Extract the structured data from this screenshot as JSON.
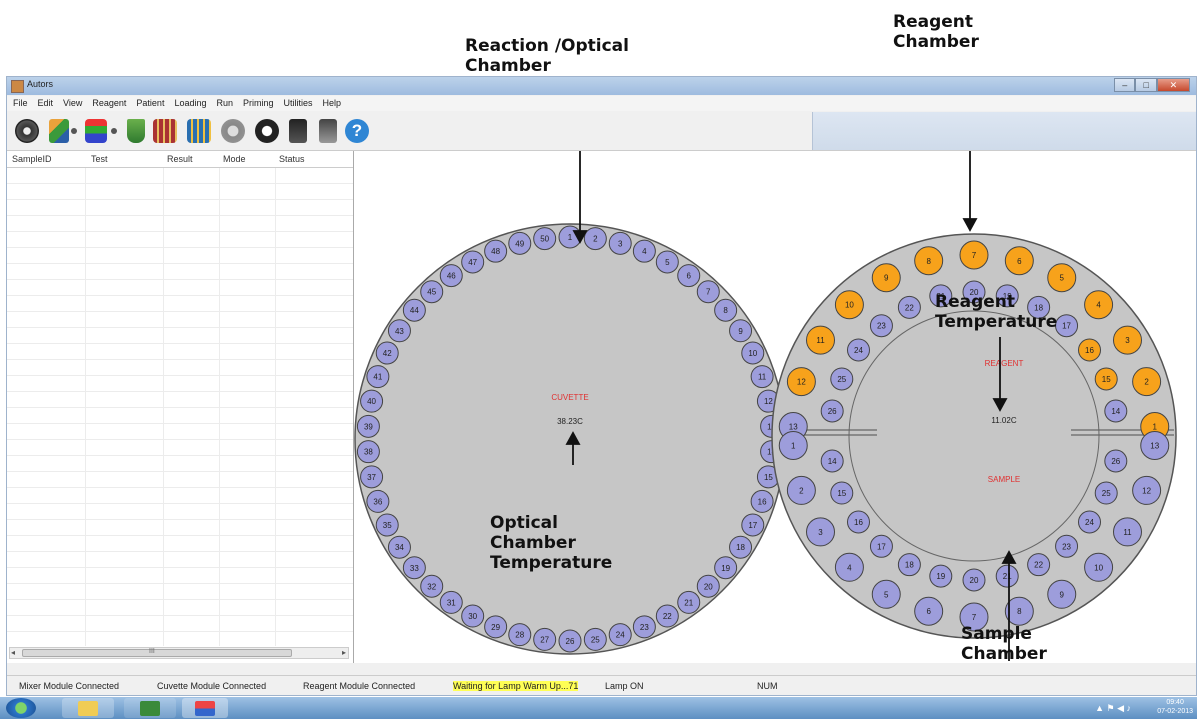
{
  "annotations": {
    "reaction_chamber": "Reaction /Optical\nChamber",
    "reagent_chamber": "Reagent\nChamber",
    "reagent_temperature": "Reagent\nTemperature",
    "optical_temperature": "Optical\nChamber\nTemperature",
    "sample_chamber": "Sample\nChamber"
  },
  "window": {
    "title": "Autors",
    "menu": [
      "File",
      "Edit",
      "View",
      "Reagent",
      "Patient",
      "Loading",
      "Run",
      "Priming",
      "Utilities",
      "Help"
    ]
  },
  "toolbar_icons": [
    "disc-icon",
    "tree-icon",
    "flask-stack-icon",
    "flask-icon",
    "bar-chart-icon",
    "bar-chart-2-icon",
    "play-icon",
    "stop-icon",
    "lamp-off-icon",
    "lamp-on-icon",
    "help-icon"
  ],
  "table": {
    "columns": [
      "SampleID",
      "Test",
      "Result",
      "Mode",
      "Status"
    ],
    "scroll_marker": "III"
  },
  "cuvette": {
    "label": "CUVETTE",
    "temperature": "38.23C",
    "positions": [
      "1",
      "2",
      "3",
      "4",
      "5",
      "6",
      "7",
      "8",
      "9",
      "10",
      "11",
      "12",
      "13",
      "14",
      "15",
      "16",
      "17",
      "18",
      "19",
      "20",
      "21",
      "22",
      "23",
      "24",
      "25",
      "26",
      "27",
      "28",
      "29",
      "30",
      "31",
      "32",
      "33",
      "34",
      "35",
      "36",
      "37",
      "38",
      "39",
      "40",
      "41",
      "42",
      "43",
      "44",
      "45",
      "46",
      "47",
      "48",
      "49",
      "50"
    ]
  },
  "reagent_tray": {
    "reagent_label": "REAGENT",
    "sample_label": "SAMPLE",
    "temperature": "11.02C",
    "reagent_outer": [
      "1",
      "2",
      "3",
      "4",
      "5",
      "6",
      "7",
      "8",
      "9",
      "10",
      "11",
      "12",
      "13"
    ],
    "reagent_inner": [
      "14",
      "15",
      "16",
      "17",
      "18",
      "19",
      "20",
      "21",
      "22",
      "23",
      "24",
      "25",
      "26"
    ],
    "loaded_reagent_outer": [
      "1",
      "2",
      "3",
      "4",
      "5",
      "6",
      "7",
      "8",
      "9",
      "10",
      "11",
      "12"
    ],
    "loaded_reagent_inner": [
      "15",
      "16"
    ],
    "sample_outer": [
      "13",
      "12",
      "11",
      "10",
      "9",
      "8",
      "7",
      "6",
      "5",
      "4",
      "3",
      "2",
      "1"
    ],
    "sample_inner": [
      "26",
      "25",
      "24",
      "23",
      "22",
      "21",
      "20",
      "19",
      "18",
      "17",
      "16",
      "15",
      "14"
    ]
  },
  "status_bar": {
    "items": [
      "Mixer Module Connected",
      "Cuvette Module Connected",
      "Reagent Module Connected",
      "Waiting for Lamp Warm Up...71",
      "Lamp ON",
      "NUM"
    ]
  },
  "taskbar": {
    "time": "09:40",
    "date": "07-02-2013"
  },
  "colors": {
    "cell_blue": "#9d9ddb",
    "cell_orange": "#f7a21b",
    "chamber_gray": "#c6c6c6",
    "label_red": "#e03030",
    "status_highlight": "#ffff55"
  }
}
